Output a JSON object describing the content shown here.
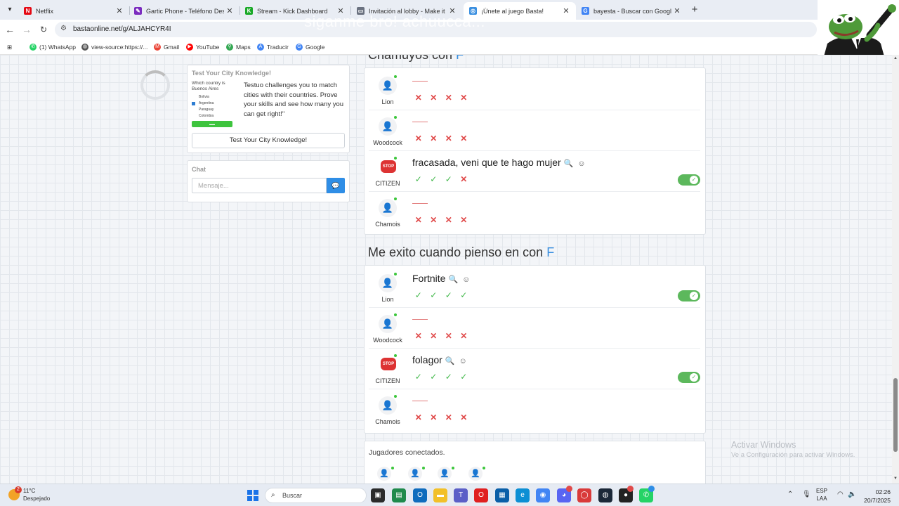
{
  "browser": {
    "tabs": [
      {
        "title": "Netflix",
        "favicon": "N",
        "color": "#e50914"
      },
      {
        "title": "Gartic Phone - Teléfono Descor",
        "favicon": "✎",
        "color": "#7b2cbf"
      },
      {
        "title": "Stream - Kick Dashboard",
        "favicon": "K",
        "color": "#1aa928"
      },
      {
        "title": "Invitación al lobby - Make it Me",
        "favicon": "▭",
        "color": "#6b7280"
      },
      {
        "title": "¡Únete al juego Basta!",
        "favicon": "◎",
        "color": "#3a8fe0"
      },
      {
        "title": "bayesta - Buscar con Google",
        "favicon": "G",
        "color": "#4285f4"
      }
    ],
    "active_tab": 4,
    "url": "bastaonline.net/g/ALJAHCYR4I",
    "overlay_text": "siganme bro! achuucca...",
    "bookmarks": [
      {
        "label": "(1) WhatsApp",
        "icon": "whatsapp-icon",
        "color": "#25d366"
      },
      {
        "label": "view-source:https://...",
        "icon": "globe-icon",
        "color": "#555"
      },
      {
        "label": "Gmail",
        "icon": "gmail-icon",
        "color": "#ea4335"
      },
      {
        "label": "YouTube",
        "icon": "youtube-icon",
        "color": "#ff0000"
      },
      {
        "label": "Maps",
        "icon": "maps-icon",
        "color": "#34a853"
      },
      {
        "label": "Traducir",
        "icon": "translate-icon",
        "color": "#4285f4"
      },
      {
        "label": "Google",
        "icon": "google-icon",
        "color": "#4285f4"
      }
    ]
  },
  "widget": {
    "title": "Test Your City Knowledge!",
    "mini_question": "Which country is Buenos Aires",
    "mini_options": [
      "Bolivia",
      "Argentina",
      "Paraguay",
      "Colombia"
    ],
    "description": "Testuo challenges you to match cities with their countries. Prove your skills and see how many you can get right!\"",
    "button": "Test Your City Knowledge!"
  },
  "chat": {
    "title": "Chat",
    "placeholder": "Mensaje..."
  },
  "categories": [
    {
      "title_prefix": "Chamuyos con",
      "letter": "F",
      "rows": [
        {
          "player": "Lion",
          "answer": "",
          "votes": [
            "no",
            "no",
            "no",
            "no"
          ],
          "approved": false,
          "avatar": "user"
        },
        {
          "player": "Woodcock",
          "answer": "",
          "votes": [
            "no",
            "no",
            "no",
            "no"
          ],
          "approved": false,
          "avatar": "user"
        },
        {
          "player": "CITIZEN",
          "answer": "fracasada, veni que te hago mujer",
          "votes": [
            "yes",
            "yes",
            "yes",
            "no"
          ],
          "approved": true,
          "avatar": "stop"
        },
        {
          "player": "Chamois",
          "answer": "",
          "votes": [
            "no",
            "no",
            "no",
            "no"
          ],
          "approved": false,
          "avatar": "user"
        }
      ]
    },
    {
      "title_prefix": "Me exito cuando pienso en con",
      "letter": "F",
      "rows": [
        {
          "player": "Lion",
          "answer": "Fortnite",
          "votes": [
            "yes",
            "yes",
            "yes",
            "yes"
          ],
          "approved": true,
          "avatar": "user"
        },
        {
          "player": "Woodcock",
          "answer": "",
          "votes": [
            "no",
            "no",
            "no",
            "no"
          ],
          "approved": false,
          "avatar": "user"
        },
        {
          "player": "CITIZEN",
          "answer": "folagor",
          "votes": [
            "yes",
            "yes",
            "yes",
            "yes"
          ],
          "approved": true,
          "avatar": "stop"
        },
        {
          "player": "Chamois",
          "answer": "",
          "votes": [
            "no",
            "no",
            "no",
            "no"
          ],
          "approved": false,
          "avatar": "user"
        }
      ]
    }
  ],
  "players": {
    "title": "Jugadores conectados."
  },
  "watermark": {
    "line1": "Activar Windows",
    "line2": "Ve a Configuración para activar Windows."
  },
  "taskbar": {
    "weather_temp": "11°C",
    "weather_desc": "Despejado",
    "weather_badge": "2",
    "search_placeholder": "Buscar",
    "lang_top": "ESP",
    "lang_bottom": "LAA",
    "time": "02:26",
    "date": "20/7/2025"
  }
}
